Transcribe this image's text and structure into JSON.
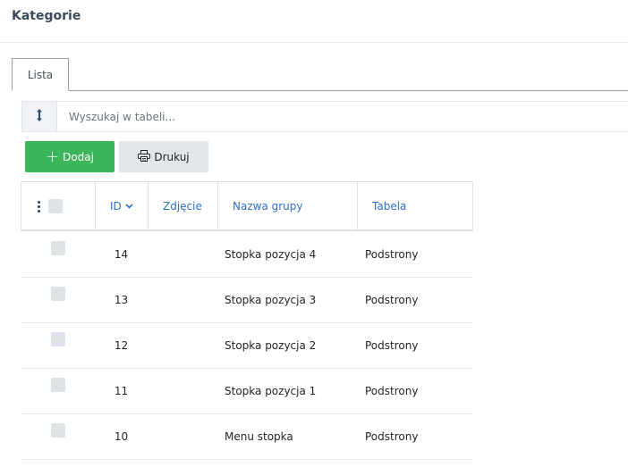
{
  "page": {
    "title": "Kategorie"
  },
  "tabs": [
    {
      "label": "Lista"
    }
  ],
  "search": {
    "placeholder": "Wyszukaj w tabeli..."
  },
  "toolbar": {
    "add_label": "Dodaj",
    "print_label": "Drukuj"
  },
  "colors": {
    "add_button": "#3cb55b",
    "header_link": "#2f6fc9",
    "print_button": "#e2e5ea"
  },
  "table": {
    "columns": {
      "id": "ID",
      "photo": "Zdjęcie",
      "name": "Nazwa grupy",
      "table": "Tabela"
    },
    "sort": {
      "column": "ID",
      "direction": "desc"
    },
    "rows": [
      {
        "id": "14",
        "name": "Stopka pozycja 4",
        "table": "Podstrony"
      },
      {
        "id": "13",
        "name": "Stopka pozycja 3",
        "table": "Podstrony"
      },
      {
        "id": "12",
        "name": "Stopka pozycja 2",
        "table": "Podstrony"
      },
      {
        "id": "11",
        "name": "Stopka pozycja 1",
        "table": "Podstrony"
      },
      {
        "id": "10",
        "name": "Menu stopka",
        "table": "Podstrony"
      }
    ]
  }
}
